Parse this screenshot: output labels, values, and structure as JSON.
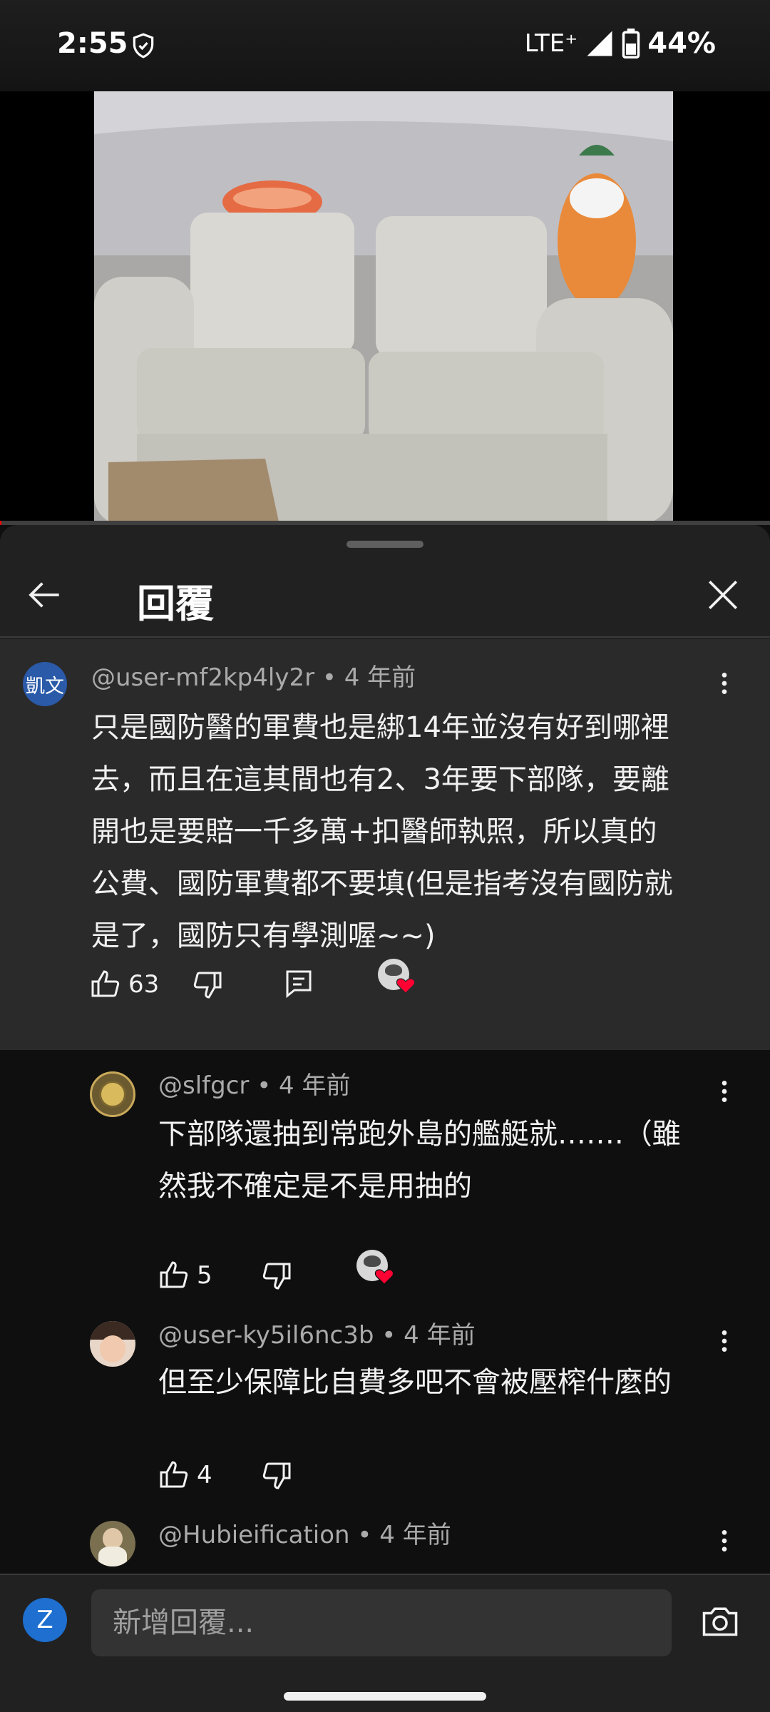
{
  "status_bar": {
    "time": "2:55",
    "network": "LTE⁺",
    "battery": "44%"
  },
  "video": {
    "progress_percent": 0.2
  },
  "sheet": {
    "title": "回覆"
  },
  "parent_comment": {
    "avatar_text": "凱文",
    "avatar_color": "#2a5aa8",
    "author": "@user-mf2kp4ly2r",
    "time": " • 4 年前",
    "lines": [
      "只是國防醫的軍費也是綁14年並沒有好到哪裡",
      "去，而且在這其間也有2、3年要下部隊，要離",
      "開也是要賠一千多萬+扣醫師執照，所以真的",
      "公費、國防軍費都不要填(但是指考沒有國防就",
      "是了，國防只有學測喔~~)"
    ],
    "likes": "63"
  },
  "replies": [
    {
      "author": "@slfgcr",
      "time": " • 4 年前",
      "lines": [
        "下部隊還抽到常跑外島的艦艇就…….（雖",
        "然我不確定是不是用抽的"
      ],
      "likes": "5"
    },
    {
      "author": "@user-ky5il6nc3b",
      "time": " • 4 年前",
      "lines": [
        "但至少保障比自費多吧不會被壓榨什麼的"
      ],
      "likes": "4"
    },
    {
      "author": "@Hubieification",
      "time": " • 4 年前"
    }
  ],
  "composer": {
    "avatar_letter": "Z",
    "placeholder": "新增回覆..."
  },
  "colors": {
    "accent_red": "#ff0000",
    "heart": "#ff0033",
    "avatar_blue": "#1e6fd0"
  }
}
